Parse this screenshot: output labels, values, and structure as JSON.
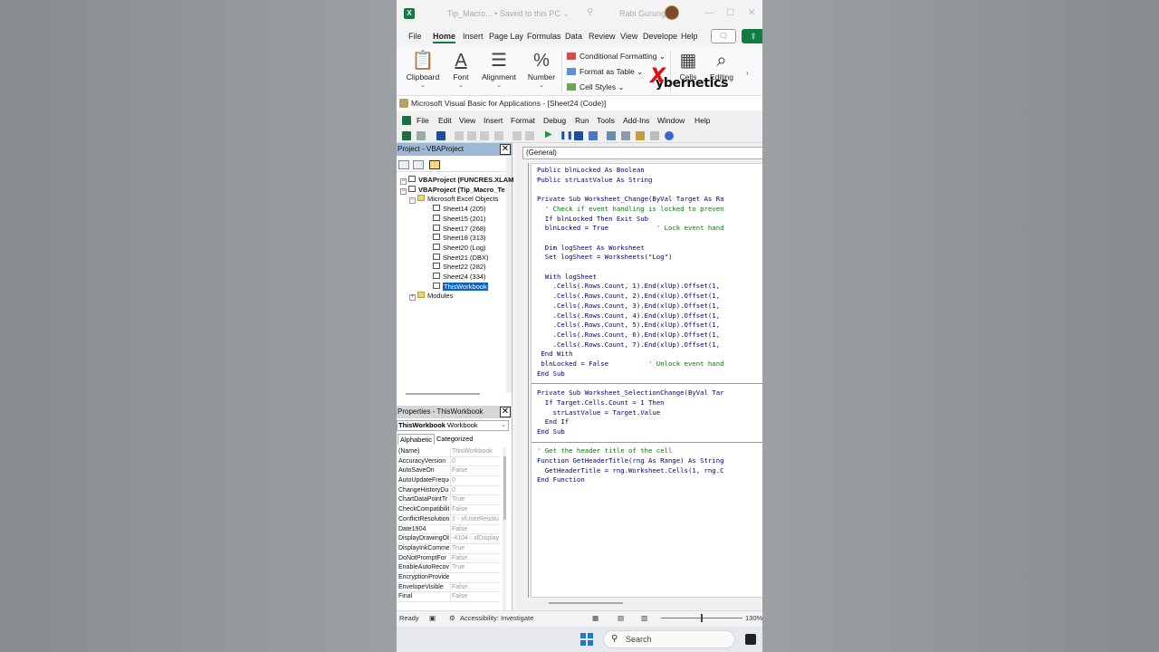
{
  "excel": {
    "doc_title": "Tip_Macro... • Saved to this PC ⌄",
    "user": "Rabi Gurung",
    "tabs": [
      "File",
      "Home",
      "Insert",
      "Page Lay",
      "Formulas",
      "Data",
      "Review",
      "View",
      "Develope",
      "Help"
    ],
    "active_tab": "Home",
    "ribbon": {
      "clipboard": "Clipboard",
      "font": "Font",
      "alignment": "Alignment",
      "number": "Number",
      "conditional_formatting": "Conditional Formatting ⌄",
      "format_as_table": "Format as Table ⌄",
      "cell_styles": "Cell Styles ⌄",
      "cells": "Cells",
      "editing": "Editing"
    },
    "watermark": "ybernetics",
    "watermark_prefix": "X"
  },
  "vbe": {
    "title": "Microsoft Visual Basic for Applications - [Sheet24 (Code)]",
    "menu": [
      "File",
      "Edit",
      "View",
      "Insert",
      "Format",
      "Debug",
      "Run",
      "Tools",
      "Add-Ins",
      "Window",
      "Help"
    ],
    "project": {
      "header": "Project - VBAProject",
      "nodes": [
        {
          "label": "VBAProject (FUNCRES.XLAM",
          "bold": true
        },
        {
          "label": "VBAProject (Tip_Macro_Te",
          "bold": true
        },
        {
          "label": "Microsoft Excel Objects"
        },
        {
          "label": "Sheet14 (205)"
        },
        {
          "label": "Sheet15 (201)"
        },
        {
          "label": "Sheet17 (268)"
        },
        {
          "label": "Sheet18 (313)"
        },
        {
          "label": "Sheet20 (Log)"
        },
        {
          "label": "Sheet21 (DBX)"
        },
        {
          "label": "Sheet22 (282)"
        },
        {
          "label": "Sheet24 (334)"
        },
        {
          "label": "ThisWorkbook",
          "selected": true
        },
        {
          "label": "Modules"
        }
      ]
    },
    "properties": {
      "header": "Properties - ThisWorkbook",
      "object_name": "ThisWorkbook",
      "object_type": "Workbook",
      "tabs": [
        "Alphabetic",
        "Categorized"
      ],
      "rows": [
        [
          "(Name)",
          "ThisWorkbook"
        ],
        [
          "AccuracyVersion",
          "0"
        ],
        [
          "AutoSaveOn",
          "False"
        ],
        [
          "AutoUpdateFreque",
          "0"
        ],
        [
          "ChangeHistoryDu",
          "0"
        ],
        [
          "ChartDataPointTr",
          "True"
        ],
        [
          "CheckCompatibilit",
          "False"
        ],
        [
          "ConflictResolution",
          "1 - xlUserResolu"
        ],
        [
          "Date1904",
          "False"
        ],
        [
          "DisplayDrawingOb",
          "-4104 - xlDisplay"
        ],
        [
          "DisplayInkComme",
          "True"
        ],
        [
          "DoNotPromptFor",
          "False"
        ],
        [
          "EnableAutoRecov",
          "True"
        ],
        [
          "EncryptionProvide",
          ""
        ],
        [
          "EnvelopeVisible",
          "False"
        ],
        [
          "Final",
          "False"
        ]
      ]
    },
    "code": {
      "procedure": "(General)",
      "lines": [
        {
          "t": "Public blnLocked As Boolean"
        },
        {
          "t": "Public strLastValue As String"
        },
        {
          "t": ""
        },
        {
          "t": "Private Sub Worksheet_Change(ByVal Target As Ra"
        },
        {
          "t": "  ' Check if event handling is locked to preven",
          "c": true
        },
        {
          "t": "  If blnLocked Then Exit Sub"
        },
        {
          "t": "  blnLocked = True            ",
          "tail": "' Lock event hand"
        },
        {
          "t": ""
        },
        {
          "t": "  Dim logSheet As Worksheet"
        },
        {
          "t": "  Set logSheet = Worksheets(\"Log\")"
        },
        {
          "t": ""
        },
        {
          "t": "  With logSheet"
        },
        {
          "t": "    .Cells(.Rows.Count, 1).End(xlUp).Offset(1,"
        },
        {
          "t": "    .Cells(.Rows.Count, 2).End(xlUp).Offset(1,"
        },
        {
          "t": "    .Cells(.Rows.Count, 3).End(xlUp).Offset(1,"
        },
        {
          "t": "    .Cells(.Rows.Count, 4).End(xlUp).Offset(1,"
        },
        {
          "t": "    .Cells(.Rows.Count, 5).End(xlUp).Offset(1,"
        },
        {
          "t": "    .Cells(.Rows.Count, 6).End(xlUp).Offset(1,"
        },
        {
          "t": "    .Cells(.Rows.Count, 7).End(xlUp).Offset(1,"
        },
        {
          "t": " End With"
        },
        {
          "t": " blnLocked = False          ",
          "tail": "' Unlock event hand"
        },
        {
          "t": "End Sub"
        },
        {
          "t": "",
          "div": true
        },
        {
          "t": "Private Sub Worksheet_SelectionChange(ByVal Tar"
        },
        {
          "t": "  If Target.Cells.Count = 1 Then"
        },
        {
          "t": "    strLastValue = Target.Value"
        },
        {
          "t": "  End If"
        },
        {
          "t": "End Sub"
        },
        {
          "t": "",
          "div": true
        },
        {
          "t": "' Get the header title of the cell",
          "c": true
        },
        {
          "t": "Function GetHeaderTitle(rng As Range) As String"
        },
        {
          "t": "  GetHeaderTitle = rng.Worksheet.Cells(1, rng.C"
        },
        {
          "t": "End Function"
        }
      ]
    }
  },
  "status": {
    "ready": "Ready",
    "accessibility": "Accessibility: Investigate",
    "zoom": "130%"
  },
  "taskbar": {
    "search_placeholder": "Search"
  }
}
